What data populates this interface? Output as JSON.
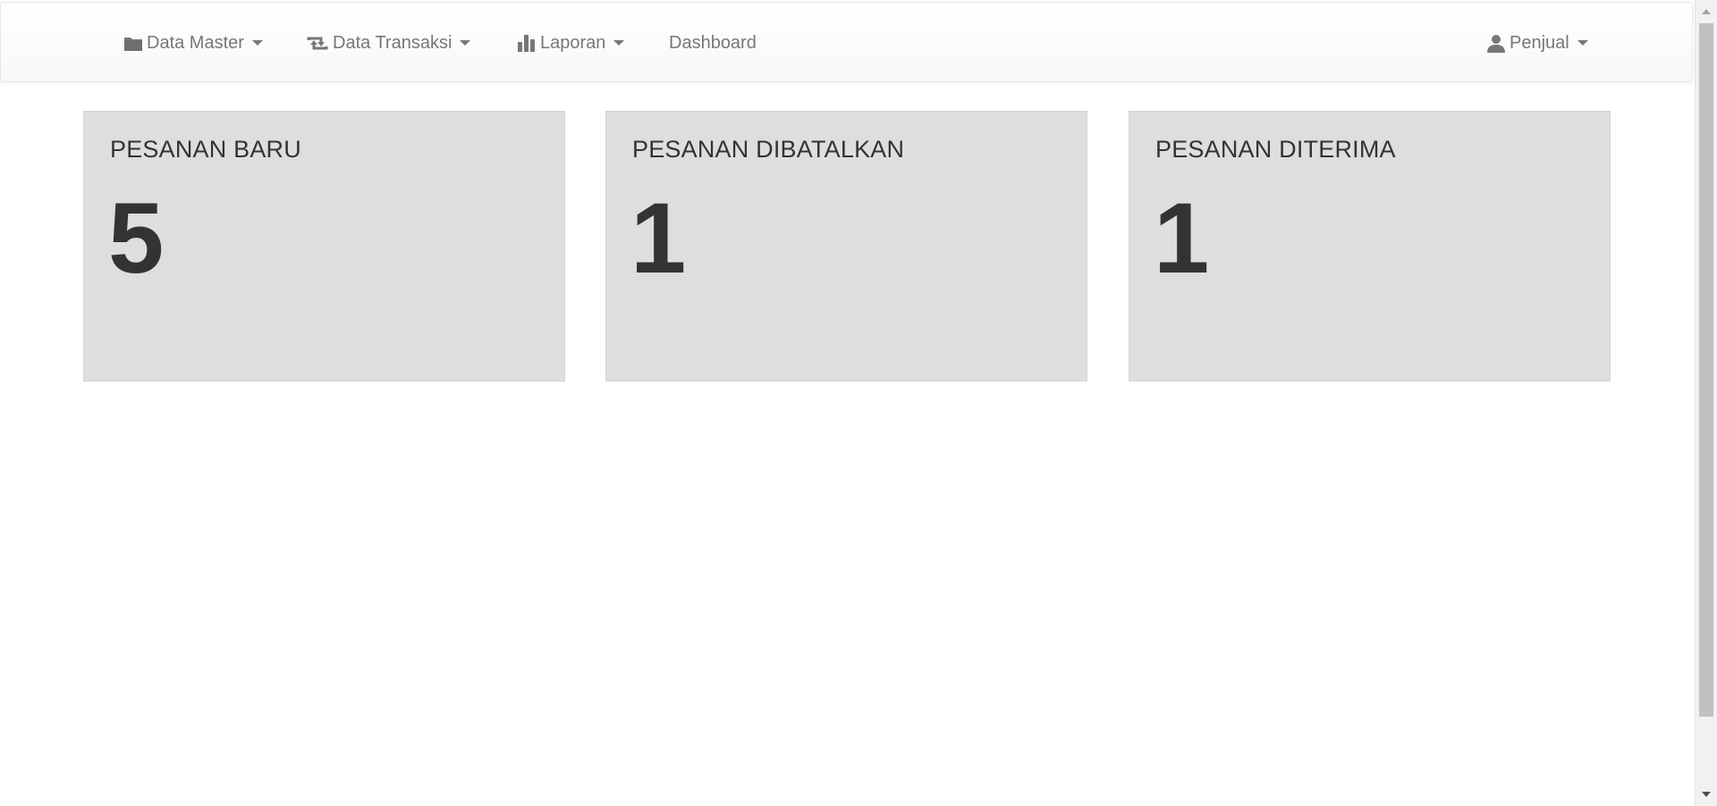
{
  "navbar": {
    "items": [
      {
        "label": "Data Master",
        "icon": "folder-icon",
        "dropdown": true
      },
      {
        "label": "Data Transaksi",
        "icon": "retweet-icon",
        "dropdown": true
      },
      {
        "label": "Laporan",
        "icon": "bar-chart-icon",
        "dropdown": true
      },
      {
        "label": "Dashboard",
        "icon": "",
        "dropdown": false
      }
    ],
    "user": {
      "label": "Penjual",
      "icon": "user-icon",
      "dropdown": true
    }
  },
  "cards": [
    {
      "title": "PESANAN BARU",
      "value": "5"
    },
    {
      "title": "PESANAN DIBATALKAN",
      "value": "1"
    },
    {
      "title": "PESANAN DITERIMA",
      "value": "1"
    }
  ],
  "colors": {
    "navbar_bg": "#f8f8f8",
    "nav_text": "#777777",
    "card_bg": "#dedede",
    "card_text": "#333333"
  }
}
